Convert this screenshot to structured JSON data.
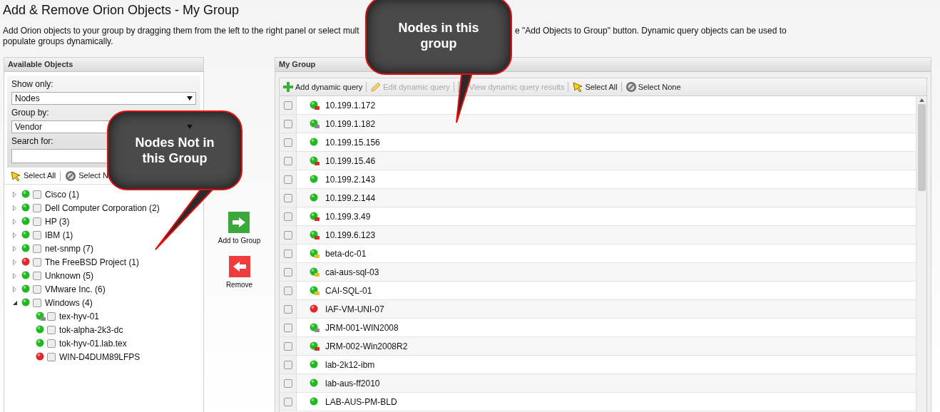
{
  "title": "Add & Remove Orion Objects - My Group",
  "description": {
    "before": "Add Orion objects to your group by dragging them from the left to the right panel or select mult",
    "after": "e \"Add Objects to Group\" button. Dynamic query objects can be used to",
    "line2": "populate groups dynamically."
  },
  "available": {
    "title": "Available Objects",
    "show_only_label": "Show only:",
    "show_only": "Nodes",
    "group_by_label": "Group by:",
    "group_by": "Vendor",
    "search_label": "Search for:",
    "select_all": "Select All",
    "select_none": "Select N",
    "tree": [
      {
        "label": "Cisco (1)",
        "expanded": false,
        "checked": false,
        "color": "#22b822"
      },
      {
        "label": "Dell Computer Corporation (2)",
        "expanded": false,
        "checked": false,
        "color": "#22b822"
      },
      {
        "label": "HP (3)",
        "expanded": false,
        "checked": false,
        "color": "#22b822"
      },
      {
        "label": "IBM (1)",
        "expanded": false,
        "checked": false,
        "color": "#22b822"
      },
      {
        "label": "net-snmp (7)",
        "expanded": false,
        "checked": false,
        "color": "#22b822"
      },
      {
        "label": "The FreeBSD Project (1)",
        "expanded": false,
        "checked": false,
        "color": "#e02828"
      },
      {
        "label": "Unknown (5)",
        "expanded": false,
        "checked": false,
        "color": "#22b822"
      },
      {
        "label": "VMware Inc. (6)",
        "expanded": false,
        "checked": false,
        "color": "#22b822"
      },
      {
        "label": "Windows (4)",
        "expanded": true,
        "checked": false,
        "color": "#22b822",
        "children": [
          {
            "label": "tex-hyv-01",
            "checked": false,
            "color": "#22b822",
            "badge": {
              "color": "#8a8a8a"
            }
          },
          {
            "label": "tok-alpha-2k3-dc",
            "checked": false,
            "color": "#22b822"
          },
          {
            "label": "tok-hyv-01.lab.tex",
            "checked": false,
            "color": "#22b822"
          },
          {
            "label": "WIN-D4DUM89LFPS",
            "checked": false,
            "color": "#e02828"
          }
        ]
      }
    ]
  },
  "actions": {
    "add": "Add to Group",
    "remove": "Remove"
  },
  "group": {
    "title": "My Group",
    "toolbar": [
      {
        "kind": "add",
        "label": "Add dynamic query",
        "disabled": false
      },
      {
        "kind": "edit",
        "label": "Edit dynamic query",
        "disabled": true
      },
      {
        "kind": "view",
        "label": "View dynamic query results",
        "disabled": true
      },
      {
        "kind": "select-all",
        "label": "Select All",
        "disabled": false
      },
      {
        "kind": "select-none",
        "label": "Select None",
        "disabled": false
      }
    ],
    "rows": [
      {
        "name": "10.199.1.172",
        "checked": false,
        "color": "#22b822",
        "badge": {
          "color": "#e02828"
        }
      },
      {
        "name": "10.199.1.182",
        "checked": false,
        "color": "#22b822",
        "badge": {
          "color": "#8a8a8a"
        }
      },
      {
        "name": "10.199.15.156",
        "checked": false,
        "color": "#22b822"
      },
      {
        "name": "10.199.15.46",
        "checked": false,
        "color": "#22b822",
        "badge": {
          "color": "#e02828"
        }
      },
      {
        "name": "10.199.2.143",
        "checked": false,
        "color": "#22b822"
      },
      {
        "name": "10.199.2.144",
        "checked": false,
        "color": "#22b822"
      },
      {
        "name": "10.199.3.49",
        "checked": false,
        "color": "#22b822",
        "badge": {
          "color": "#e02828"
        }
      },
      {
        "name": "10.199.6.123",
        "checked": false,
        "color": "#22b822",
        "badge": {
          "color": "#e02828"
        }
      },
      {
        "name": "beta-dc-01",
        "checked": false,
        "color": "#22b822",
        "badge": {
          "color": "#e8c020"
        }
      },
      {
        "name": "cai-aus-sql-03",
        "checked": false,
        "color": "#22b822",
        "badge": {
          "color": "#e8c020"
        }
      },
      {
        "name": "CAI-SQL-01",
        "checked": false,
        "color": "#22b822",
        "badge": {
          "color": "#e8c020"
        }
      },
      {
        "name": "IAF-VM-UNI-07",
        "checked": false,
        "color": "#e02828"
      },
      {
        "name": "JRM-001-WIN2008",
        "checked": false,
        "color": "#22b822",
        "badge": {
          "color": "#8a8a8a"
        }
      },
      {
        "name": "JRM-002-Win2008R2",
        "checked": false,
        "color": "#22b822",
        "badge": {
          "color": "#e02828"
        }
      },
      {
        "name": "lab-2k12-ibm",
        "checked": false,
        "color": "#22b822"
      },
      {
        "name": "lab-aus-ff2010",
        "checked": false,
        "color": "#22b822"
      },
      {
        "name": "LAB-AUS-PM-BLD",
        "checked": false,
        "color": "#22b822"
      }
    ]
  },
  "callouts": [
    {
      "text": "Nodes in this group"
    },
    {
      "text": "Nodes Not in this Group"
    }
  ]
}
